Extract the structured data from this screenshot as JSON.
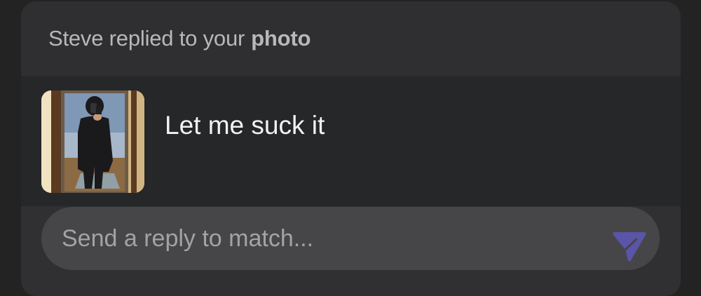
{
  "notification": {
    "header_prefix": "Steve replied to your",
    "header_emphasis": "photo",
    "message": "Let me suck it",
    "thumbnail_icon": "photo-thumbnail"
  },
  "reply": {
    "placeholder": "Send a reply to match...",
    "value": "",
    "send_icon": "send-icon",
    "send_icon_color": "#5a55a8"
  },
  "colors": {
    "page_background": "#232323",
    "card_background": "#262729",
    "header_background": "#2f2f31",
    "input_background": "#464648"
  }
}
